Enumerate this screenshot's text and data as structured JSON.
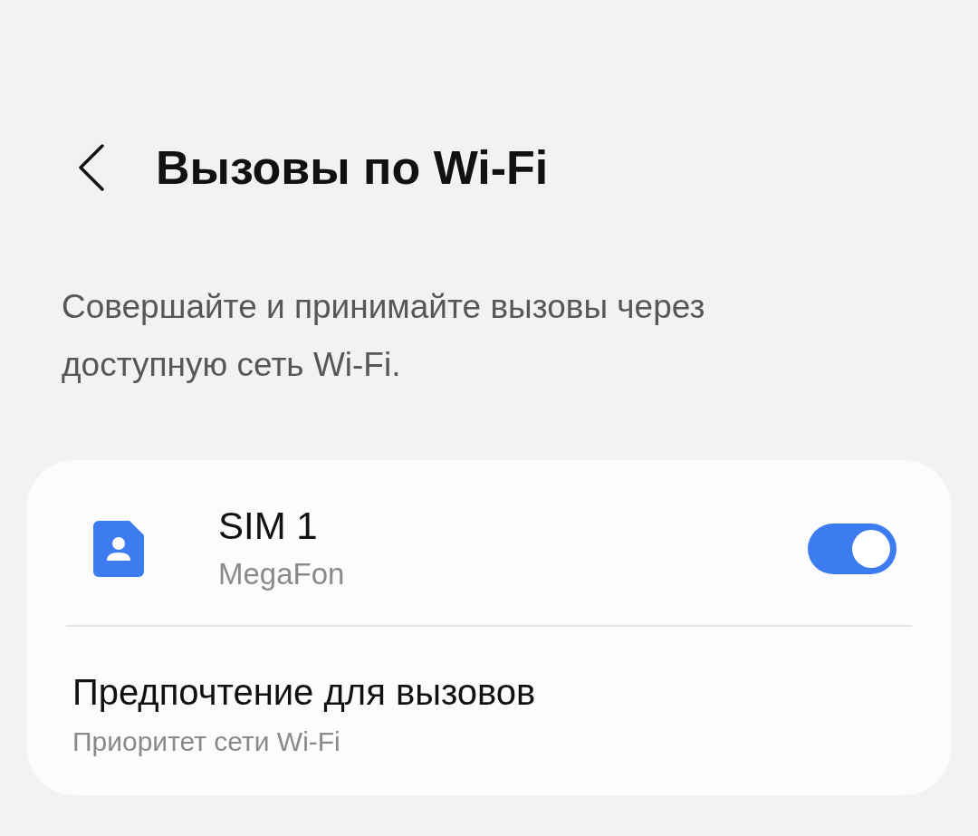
{
  "header": {
    "title": "Вызовы по Wi-Fi"
  },
  "description": "Совершайте и принимайте вызовы через доступную сеть Wi-Fi.",
  "settings": [
    {
      "kind": "sim",
      "title": "SIM 1",
      "subtitle": "MegaFon",
      "on": true
    },
    {
      "kind": "option",
      "title": "Предпочтение для вызовов",
      "subtitle": "Приоритет сети Wi-Fi"
    }
  ]
}
